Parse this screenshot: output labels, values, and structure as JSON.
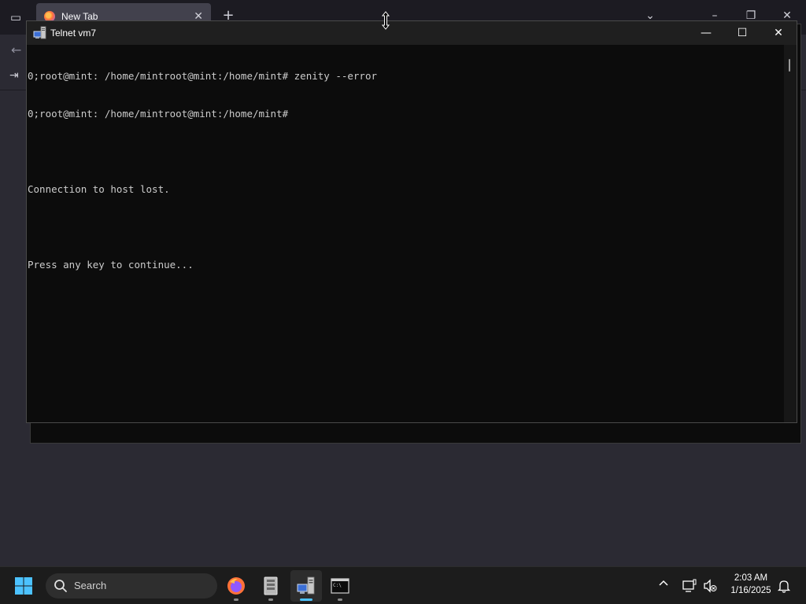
{
  "browser": {
    "tab_title": "New Tab",
    "tab_close": "✕",
    "new_tab": "+",
    "list_all_tabs": "⌄",
    "minimize": "–",
    "restore": "❐",
    "close": "✕",
    "back": "←",
    "sign_in_icon": "⇥"
  },
  "telnet": {
    "title": "Telnet vm7",
    "minimize": "—",
    "maximize": "☐",
    "close": "✕",
    "lines": [
      "0;root@mint: /home/mintroot@mint:/home/mint# zenity --error",
      "0;root@mint: /home/mintroot@mint:/home/mint#",
      "",
      "Connection to host lost.",
      "",
      "Press any key to continue..."
    ]
  },
  "taskbar": {
    "search_label": "Search",
    "apps": [
      "firefox-icon",
      "file-archive-icon",
      "telnet-icon",
      "terminal-icon"
    ],
    "active_app": "telnet-icon",
    "tray_chevron": "^",
    "time": "2:03 AM",
    "date": "1/16/2025"
  },
  "colors": {
    "accent": "#4cc2ff",
    "console_bg": "#0c0c0c",
    "console_fg": "#cccccc",
    "taskbar_bg": "#1c1c1c"
  }
}
